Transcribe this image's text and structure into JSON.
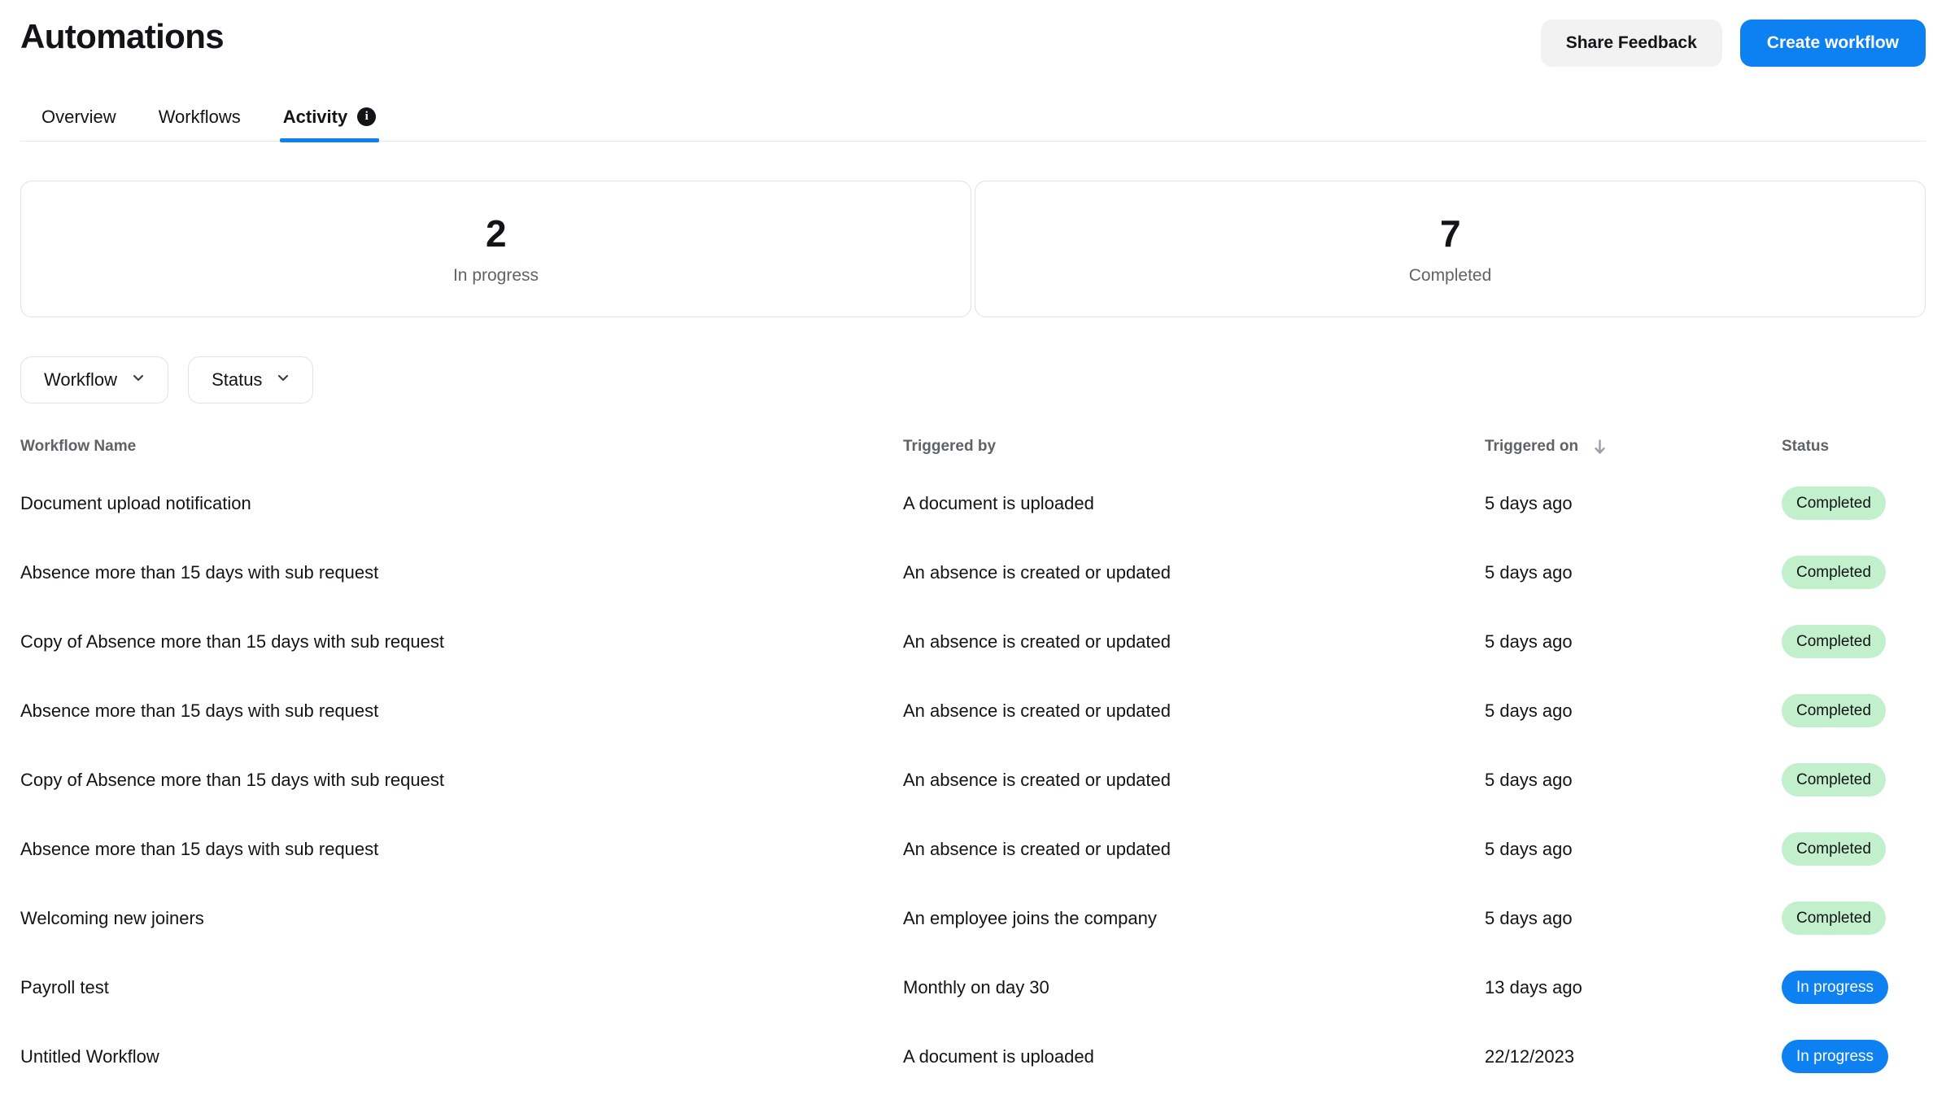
{
  "header": {
    "title": "Automations",
    "share_feedback_label": "Share Feedback",
    "create_workflow_label": "Create workflow"
  },
  "tabs": [
    {
      "label": "Overview",
      "active": false,
      "has_info_icon": false
    },
    {
      "label": "Workflows",
      "active": false,
      "has_info_icon": false
    },
    {
      "label": "Activity",
      "active": true,
      "has_info_icon": true,
      "info_icon": "info-icon",
      "info_glyph": "i"
    }
  ],
  "stats": [
    {
      "value": "2",
      "label": "In progress"
    },
    {
      "value": "7",
      "label": "Completed"
    }
  ],
  "filters": [
    {
      "label": "Workflow",
      "icon": "chevron-down-icon"
    },
    {
      "label": "Status",
      "icon": "chevron-down-icon"
    }
  ],
  "table": {
    "columns": [
      {
        "key": "name",
        "label": "Workflow Name",
        "sorted": false
      },
      {
        "key": "triggered_by",
        "label": "Triggered by",
        "sorted": false
      },
      {
        "key": "triggered_on",
        "label": "Triggered on",
        "sorted": true,
        "sort_icon": "arrow-down-icon",
        "sort_direction": "descending"
      },
      {
        "key": "status",
        "label": "Status",
        "sorted": false
      }
    ],
    "rows": [
      {
        "name": "Document upload notification",
        "triggered_by": "A document is uploaded",
        "triggered_on": "5 days ago",
        "status": "Completed",
        "status_type": "completed"
      },
      {
        "name": "Absence more than 15 days with sub request",
        "triggered_by": "An absence is created or updated",
        "triggered_on": "5 days ago",
        "status": "Completed",
        "status_type": "completed"
      },
      {
        "name": "Copy of Absence more than 15 days with sub request",
        "triggered_by": "An absence is created or updated",
        "triggered_on": "5 days ago",
        "status": "Completed",
        "status_type": "completed"
      },
      {
        "name": "Absence more than 15 days with sub request",
        "triggered_by": "An absence is created or updated",
        "triggered_on": "5 days ago",
        "status": "Completed",
        "status_type": "completed"
      },
      {
        "name": "Copy of Absence more than 15 days with sub request",
        "triggered_by": "An absence is created or updated",
        "triggered_on": "5 days ago",
        "status": "Completed",
        "status_type": "completed"
      },
      {
        "name": "Absence more than 15 days with sub request",
        "triggered_by": "An absence is created or updated",
        "triggered_on": "5 days ago",
        "status": "Completed",
        "status_type": "completed"
      },
      {
        "name": "Welcoming new joiners",
        "triggered_by": "An employee joins the company",
        "triggered_on": "5 days ago",
        "status": "Completed",
        "status_type": "completed"
      },
      {
        "name": "Payroll test",
        "triggered_by": "Monthly on day 30",
        "triggered_on": "13 days ago",
        "status": "In progress",
        "status_type": "inprogress"
      },
      {
        "name": "Untitled Workflow",
        "triggered_by": "A document is uploaded",
        "triggered_on": "22/12/2023",
        "status": "In progress",
        "status_type": "inprogress"
      }
    ]
  },
  "colors": {
    "accent": "#0d80f2",
    "badge_completed_bg": "#c3f0cc",
    "badge_inprogress_bg": "#0d80f2",
    "secondary_button_bg": "#f2f2f2",
    "muted_text": "#5f6368",
    "border": "#e0e2e5"
  }
}
